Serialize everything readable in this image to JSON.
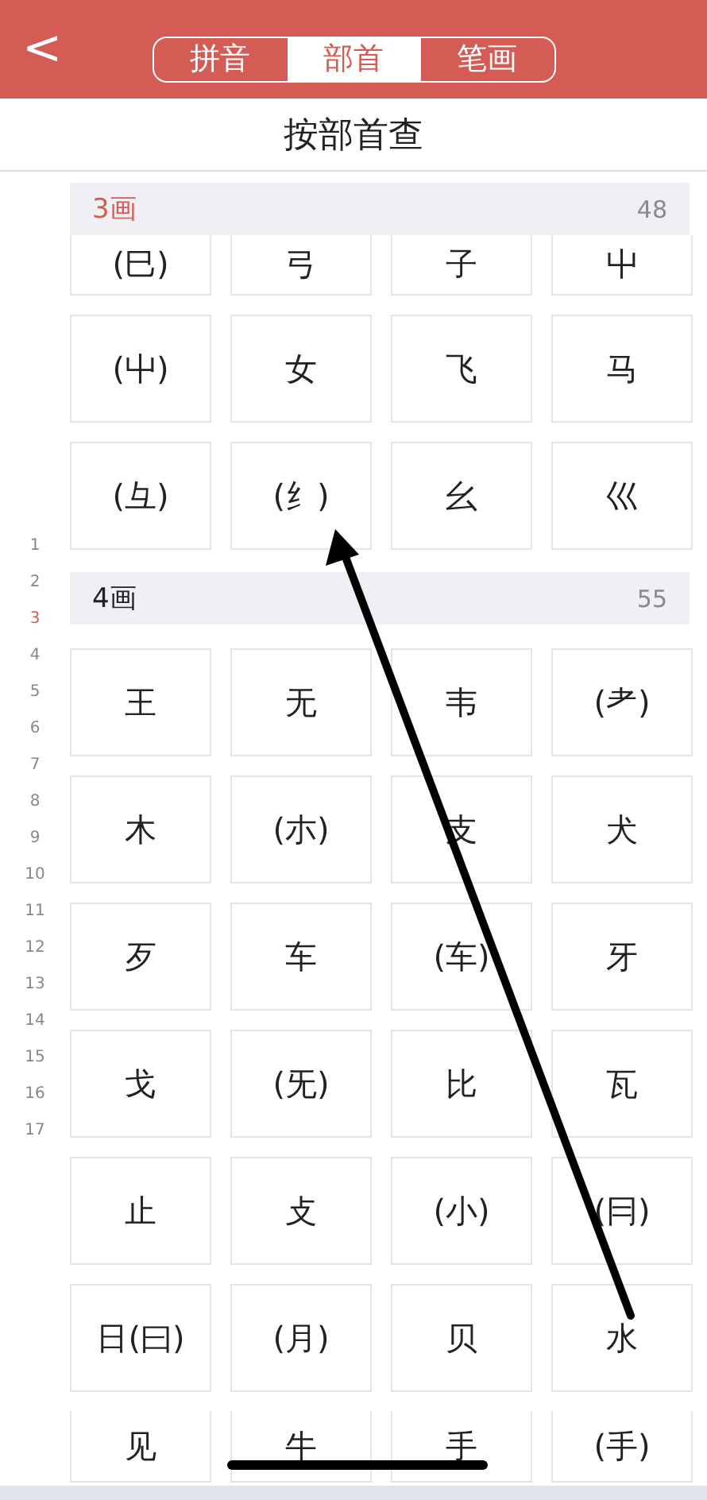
{
  "nav": {
    "back": "<",
    "tabs": [
      {
        "label": "拼音",
        "selected": false
      },
      {
        "label": "部首",
        "selected": true
      },
      {
        "label": "笔画",
        "selected": false
      }
    ]
  },
  "title": "按部首查",
  "index": [
    {
      "label": "1",
      "selected": false
    },
    {
      "label": "2",
      "selected": false
    },
    {
      "label": "3",
      "selected": true
    },
    {
      "label": "4",
      "selected": false
    },
    {
      "label": "5",
      "selected": false
    },
    {
      "label": "6",
      "selected": false
    },
    {
      "label": "7",
      "selected": false
    },
    {
      "label": "8",
      "selected": false
    },
    {
      "label": "9",
      "selected": false
    },
    {
      "label": "10",
      "selected": false
    },
    {
      "label": "11",
      "selected": false
    },
    {
      "label": "12",
      "selected": false
    },
    {
      "label": "13",
      "selected": false
    },
    {
      "label": "14",
      "selected": false
    },
    {
      "label": "15",
      "selected": false
    },
    {
      "label": "16",
      "selected": false
    },
    {
      "label": "17",
      "selected": false
    }
  ],
  "sections": [
    {
      "label": "3画",
      "count": "48",
      "selected": true,
      "cells": [
        "(巳)",
        "弓",
        "子",
        "屮",
        "(屮)",
        "女",
        "飞",
        "马",
        "(彑)",
        "(纟)",
        "幺",
        "巛"
      ]
    },
    {
      "label": "4画",
      "count": "55",
      "selected": false,
      "cells": [
        "王",
        "无",
        "韦",
        "(耂)",
        "木",
        "(朩)",
        "支",
        "犬",
        "歹",
        "车",
        "(车)",
        "牙",
        "戈",
        "(旡)",
        "比",
        "瓦",
        "止",
        "攴",
        "(小)",
        "(冃)",
        "日(曰)",
        "(月)",
        "贝",
        "水",
        "见",
        "牛",
        "手",
        "(手)"
      ]
    }
  ]
}
